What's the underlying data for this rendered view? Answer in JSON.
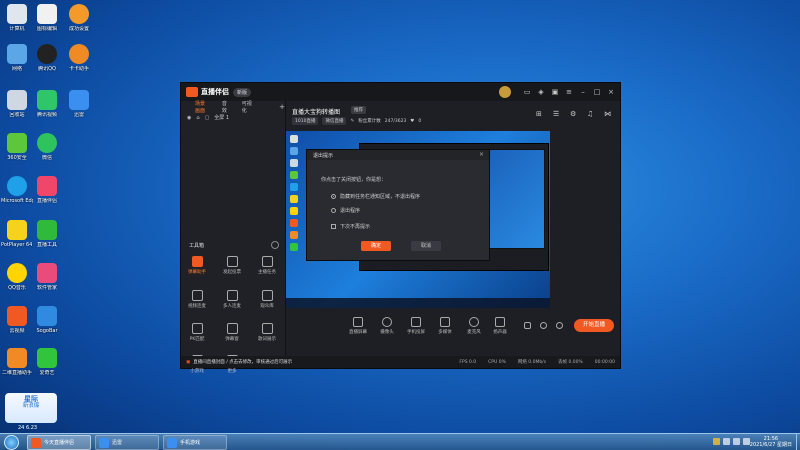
{
  "desktop": {
    "icons": [
      {
        "label": "计算机",
        "color": "#dfe6ee"
      },
      {
        "label": "图标编辑",
        "color": "#f1f1f1"
      },
      {
        "label": "成功设置",
        "color": "#f49a2b"
      },
      {
        "label": "网络",
        "color": "#5aa6e6"
      },
      {
        "label": "腾讯QQ",
        "color": "#222"
      },
      {
        "label": "卡卡助手",
        "color": "#f08a24"
      },
      {
        "label": "回收站",
        "color": "#cfd8e2"
      },
      {
        "label": "腾讯视频",
        "color": "#2fc66a"
      },
      {
        "label": "迅雷",
        "color": "#3b8ff0"
      },
      {
        "label": "360安全",
        "color": "#5dc63b"
      },
      {
        "label": "微信",
        "color": "#2ec35c"
      },
      {
        "label": "Microsoft Edge",
        "color": "#1fa0e8"
      },
      {
        "label": "直播伴侣",
        "color": "#f0466a"
      },
      {
        "label": "PotPlayer 64 bit",
        "color": "#f5d31d"
      },
      {
        "label": "直播工具",
        "color": "#2fba3c"
      },
      {
        "label": "QQ音乐",
        "color": "#ffd400"
      },
      {
        "label": "软件管家",
        "color": "#e94b7a"
      },
      {
        "label": "云视频",
        "color": "#f05a22"
      },
      {
        "label": "SogoBar",
        "color": "#2f8ae0"
      },
      {
        "label": "二维直播助手",
        "color": "#f08a24"
      },
      {
        "label": "爱奇艺",
        "color": "#31c53e"
      }
    ]
  },
  "app": {
    "name": "直播伴侣",
    "version": "新版",
    "left_tabs": [
      "场景画面",
      "音效",
      "可视化"
    ],
    "scene": {
      "label": "全屏 1"
    },
    "tools_title": "工具箱",
    "tools": [
      "弹幕助手",
      "发起投票",
      "主播任务",
      "视频连麦",
      "多人连麦",
      "观众库",
      "PK匹配",
      "弹幕窗",
      "歌词展示",
      "小游戏",
      "更多"
    ],
    "room_title": "直播大宝狗转播图",
    "room_badge": "推荐",
    "room_tags": [
      "1010直播",
      "微信直播"
    ],
    "room_stats": "粉丝累计数",
    "room_count": "247/3623",
    "room_likes": "0",
    "dialog": {
      "title": "退出提示",
      "close": "×",
      "question": "你点击了关闭按钮，你是想：",
      "option1": "隐藏到任务栏通知区域，不退出程序",
      "option2": "退出程序",
      "checkbox": "下次不再提示",
      "ok": "确定",
      "cancel": "取消"
    },
    "bottom_tools": [
      "直播屏幕",
      "摄像头",
      "手机投屏",
      "多媒体",
      "麦克风",
      "扬声器"
    ],
    "live_button": "开始直播",
    "status_warning": "直播间直播封面 / 点击去修改，审核通过后可展示",
    "status_stats": [
      "FPS 0.0",
      "CPU 0%",
      "网络 0.0Mb/s",
      "丢帧 0.00%",
      "00:00:00"
    ]
  },
  "taskbar": {
    "tasks": [
      {
        "label": "今天直播伴侣",
        "active": true,
        "color": "#f05a22"
      },
      {
        "label": "迅雷",
        "active": false,
        "color": "#3b8ff0"
      },
      {
        "label": "手机游戏",
        "active": false,
        "color": "#3b8ff0"
      }
    ],
    "time": "21:56",
    "date": "2021/6/27 星期日"
  },
  "overlay": {
    "brand": "星际",
    "sub": "新浪爆",
    "date": "24 6.23"
  }
}
